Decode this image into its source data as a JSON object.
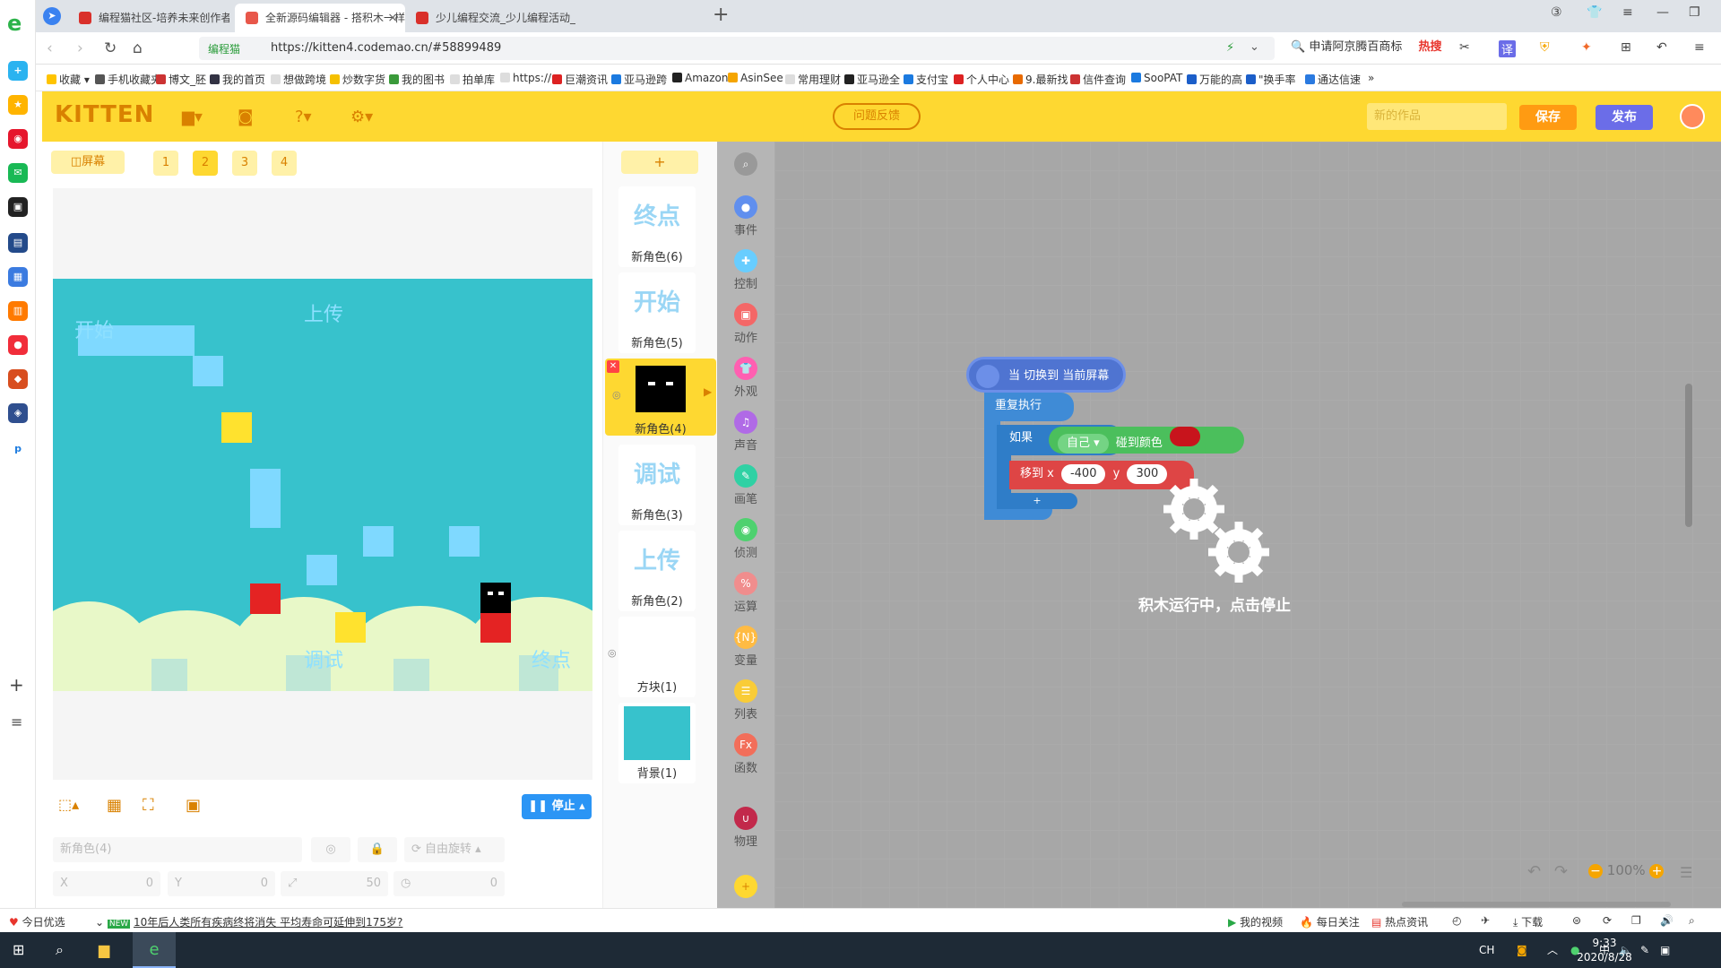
{
  "tabs": [
    {
      "title": "编程猫社区-培养未来创作者 - 汇",
      "color": "#d9302a"
    },
    {
      "title": "全新源码编辑器 - 搭积木一样有",
      "color": "#e8574a"
    },
    {
      "title": "少儿编程交流_少儿编程活动_sc",
      "color": "#d9302a"
    }
  ],
  "address": {
    "secure_label": "编程猫",
    "url": "https://kitten4.codemao.cn/#58899489"
  },
  "search": {
    "text": "申请阿京腾百商标",
    "hot": "热搜"
  },
  "bookmarks": [
    "收藏",
    "手机收藏夹",
    "博文_胚",
    "我的首页",
    "想做跨境",
    "炒数字货",
    "我的图书",
    "拍单库",
    "https://",
    "巨潮资讯",
    "亚马逊跨",
    "Amazon",
    "AsinSee",
    "常用理财",
    "亚马逊全",
    "支付宝",
    "个人中心",
    "9.最新找",
    "信件查询",
    "SooPAT",
    "万能的高",
    "\"换手率",
    "通达信速"
  ],
  "app": {
    "logo": "KITTEN",
    "feedback": "问题反馈",
    "work_title_placeholder": "新的作品",
    "save": "保存",
    "publish": "发布"
  },
  "stage": {
    "screen_btn": "屏幕",
    "pages": [
      "1",
      "2",
      "3",
      "4"
    ],
    "active_page": "2",
    "texts": {
      "start": "开始",
      "upload": "上传",
      "debug": "调试",
      "end": "终点"
    },
    "stop": "停止",
    "sprite_field": "新角色(4)",
    "rotate": "自由旋转",
    "x_label": "X",
    "x_val": "0",
    "y_label": "Y",
    "y_val": "0",
    "size_val": "50",
    "dir_val": "0"
  },
  "sprites": [
    {
      "thumb": "终点",
      "name": "新角色(6)"
    },
    {
      "thumb": "开始",
      "name": "新角色(5)"
    },
    {
      "thumb": "",
      "name": "新角色(4)",
      "selected": true
    },
    {
      "thumb": "调试",
      "name": "新角色(3)"
    },
    {
      "thumb": "上传",
      "name": "新角色(2)"
    },
    {
      "thumb": "",
      "name": "方块(1)"
    },
    {
      "thumb": "",
      "name": "背景(1)"
    }
  ],
  "categories": [
    {
      "label": "事件",
      "color": "#608fee"
    },
    {
      "label": "控制",
      "color": "#68cdff"
    },
    {
      "label": "动作",
      "color": "#f46767"
    },
    {
      "label": "外观",
      "color": "#ff5fb1"
    },
    {
      "label": "声音",
      "color": "#b06ae6"
    },
    {
      "label": "画笔",
      "color": "#2fd1a4"
    },
    {
      "label": "侦测",
      "color": "#4ed16f"
    },
    {
      "label": "运算",
      "color": "#f08d8d"
    },
    {
      "label": "变量",
      "color": "#ffbb43"
    },
    {
      "label": "列表",
      "color": "#f9cc37"
    },
    {
      "label": "函数",
      "color": "#f26e5a"
    },
    {
      "label": "物理",
      "color": "#c2294b"
    }
  ],
  "blocks": {
    "hat": "当 切换到 当前屏幕",
    "loop": "重复执行",
    "if": "如果",
    "self": "自己",
    "touch_color": "碰到颜色",
    "move": "移到 x",
    "x": "-400",
    "y_label": "y",
    "y": "300"
  },
  "running_msg": "积木运行中，点击停止",
  "zoom": "100%",
  "status": {
    "left": "今日优选",
    "news": "10年后人类所有疾病终将消失 平均寿命可延伸到175岁?",
    "video": "我的视频",
    "daily": "每日关注",
    "hot": "热点资讯",
    "download": "下载"
  },
  "taskbar": {
    "time": "9:33",
    "date": "2020/8/28",
    "ime": "中",
    "lang": "CH"
  }
}
